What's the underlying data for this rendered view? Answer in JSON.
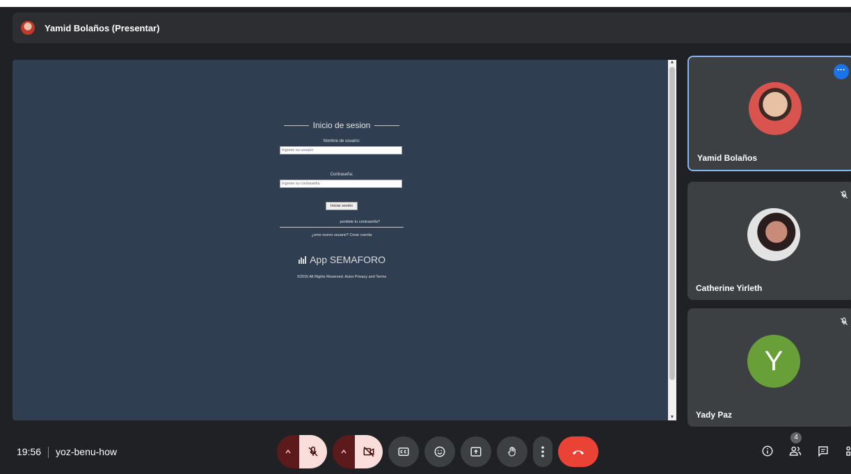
{
  "presenter": {
    "title": "Yamid Bolaños (Presentar)"
  },
  "shared_screen": {
    "heading": "Inicio de sesion",
    "username_label": "Nombre de usuario:",
    "username_placeholder": "Ingrese su usuario",
    "password_label": "Contraseña:",
    "password_placeholder": "Ingrese su contraseña",
    "login_button": "Iniciar sesión",
    "forgot_link": "perdiste tu contraseña?",
    "new_user_text": "¿eres nuevo usuario? Crear cuenta",
    "brand": "App SEMAFORO",
    "copyright": "©2016 All Rights Reserved. Autor Privacy and Terms"
  },
  "participants": [
    {
      "name": "Yamid Bolaños",
      "avatar": "photo",
      "active_speaker": true
    },
    {
      "name": "Catherine Yirleth",
      "avatar": "photo",
      "muted": true
    },
    {
      "name": "Yady Paz",
      "avatar_letter": "Y",
      "avatar_color": "#689f38",
      "muted": true
    }
  ],
  "bottom_bar": {
    "time": "19:56",
    "meeting_code": "yoz-benu-how",
    "people_count": "4",
    "controls": [
      "mic-options",
      "mic-off",
      "camera-options",
      "camera-off",
      "captions",
      "reactions",
      "present",
      "raise-hand",
      "more-options",
      "end-call"
    ],
    "right_controls": [
      "info",
      "people",
      "chat",
      "activities"
    ]
  },
  "colors": {
    "end_call": "#ea4335",
    "active_border": "#8ab4f8",
    "muted_control": "#f9dedc"
  }
}
